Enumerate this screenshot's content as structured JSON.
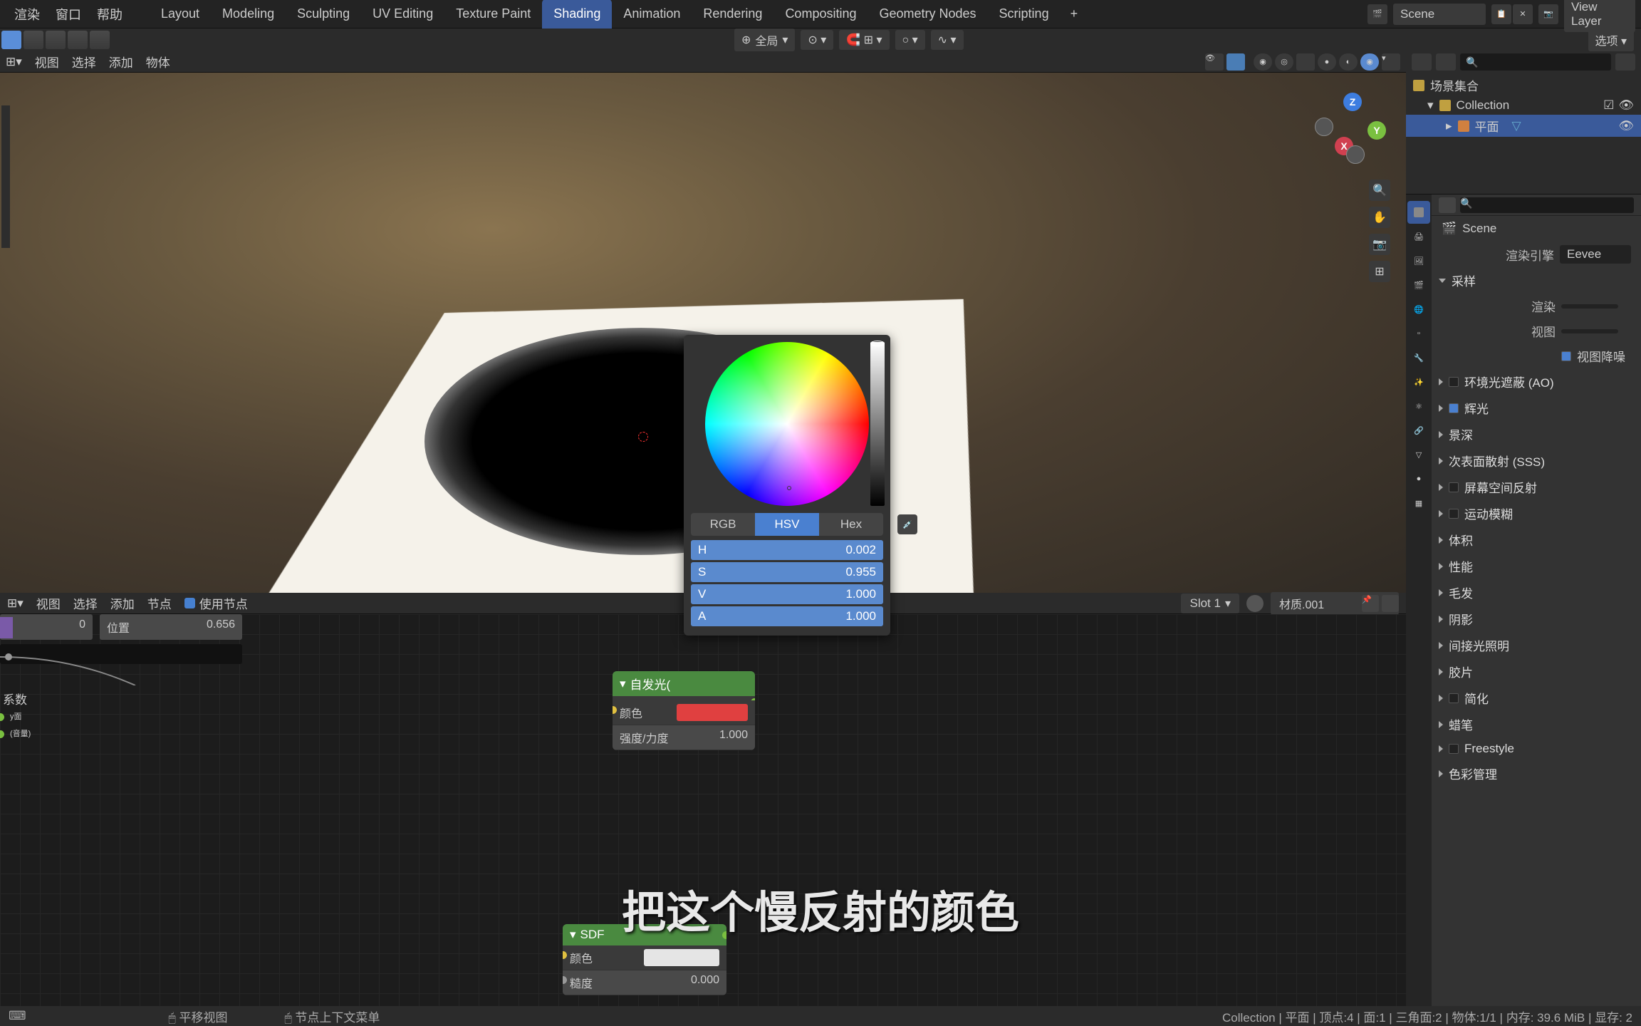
{
  "topMenu": {
    "render": "渲染",
    "window": "窗口",
    "help": "帮助"
  },
  "workspaces": {
    "layout": "Layout",
    "modeling": "Modeling",
    "sculpting": "Sculpting",
    "uv": "UV Editing",
    "texture": "Texture Paint",
    "shading": "Shading",
    "animation": "Animation",
    "rendering": "Rendering",
    "compositing": "Compositing",
    "geo": "Geometry Nodes",
    "scripting": "Scripting"
  },
  "sceneField": "Scene",
  "viewLayer": "View Layer",
  "snap": {
    "scope": "全局"
  },
  "options": "选项",
  "vpHeader": {
    "view": "视图",
    "select": "选择",
    "add": "添加",
    "object": "物体"
  },
  "nodeHeader": {
    "view": "视图",
    "select": "选择",
    "add": "添加",
    "node": "节点",
    "useNodes": "使用节点",
    "slot": "Slot 1",
    "material": "材质.001"
  },
  "nodeEditor": {
    "value1": "0",
    "position": "位置",
    "positionVal": "0.656",
    "param1": "系数",
    "emission": {
      "title": "自发光(",
      "row_color": "颜色",
      "strength": "强度/力度",
      "strengthVal": "1.000"
    },
    "output": {
      "surface": "表面",
      "volume": "(音量)"
    },
    "bsdf": {
      "title": "SDF",
      "color": "颜色",
      "rough": "糙度",
      "roughVal": "0.000"
    }
  },
  "colorPicker": {
    "rgb": "RGB",
    "hsv": "HSV",
    "hex": "Hex",
    "h": "H",
    "hv": "0.002",
    "s": "S",
    "sv": "0.955",
    "v": "V",
    "vv": "1.000",
    "a": "A",
    "av": "1.000"
  },
  "outliner": {
    "root": "场景集合",
    "collection": "Collection",
    "plane": "平面"
  },
  "properties": {
    "scene": "Scene",
    "renderEngineLab": "渲染引擎",
    "renderEngine": "Eevee",
    "samplingHead": "采样",
    "renderLab": "渲染",
    "viewLab": "视图",
    "viewportDenoise": "视图降噪",
    "sections": {
      "ao": "环境光遮蔽 (AO)",
      "bloom": "辉光",
      "dof": "景深",
      "sss": "次表面散射 (SSS)",
      "ssr": "屏幕空间反射",
      "motion": "运动模糊",
      "vol": "体积",
      "perf": "性能",
      "hair": "毛发",
      "shadow": "阴影",
      "indirect": "间接光照明",
      "film": "胶片",
      "simplify": "简化",
      "gp": "蜡笔",
      "freestyle": "Freestyle",
      "cm": "色彩管理"
    }
  },
  "statusbar": {
    "left": "平移视图",
    "ctx": "节点上下文菜单",
    "right": "Collection | 平面 | 顶点:4 | 面:1 | 三角面:2 | 物体:1/1 | 内存: 39.6 MiB | 显存: 2"
  },
  "subtitle": "把这个慢反射的颜色"
}
